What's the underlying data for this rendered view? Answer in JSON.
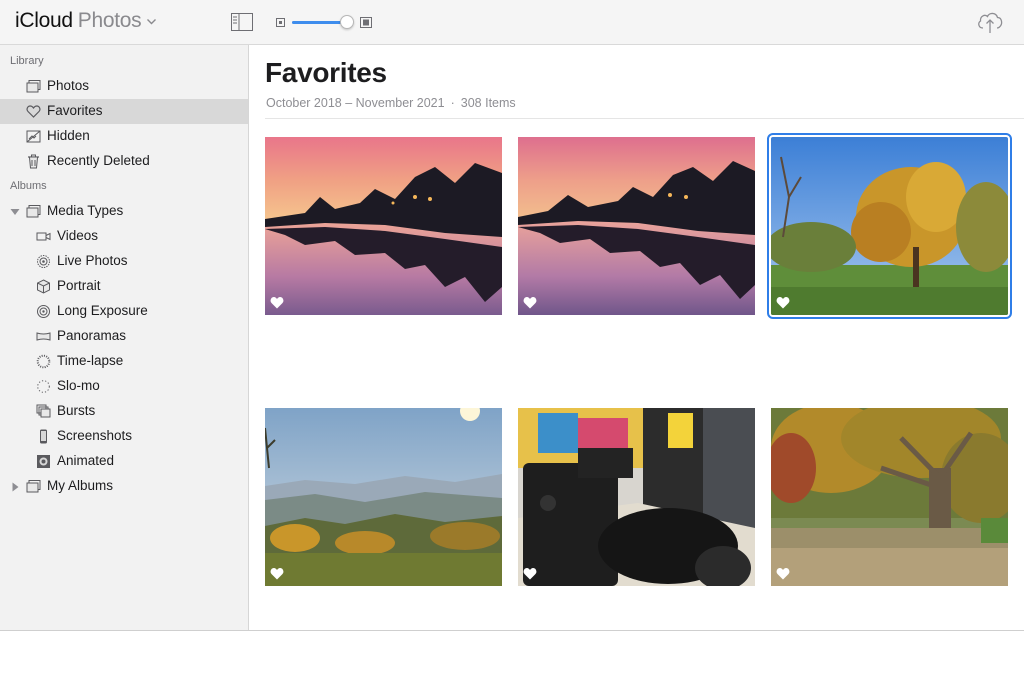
{
  "header": {
    "app_name": "iCloud",
    "section_name": "Photos"
  },
  "sidebar": {
    "library_heading": "Library",
    "library": [
      {
        "label": "Photos",
        "icon": "photos-icon"
      },
      {
        "label": "Favorites",
        "icon": "heart-icon",
        "selected": true
      },
      {
        "label": "Hidden",
        "icon": "hidden-icon"
      },
      {
        "label": "Recently Deleted",
        "icon": "trash-icon"
      }
    ],
    "albums_heading": "Albums",
    "media_types": {
      "label": "Media Types",
      "icon": "folder-icon",
      "expanded": true
    },
    "media_items": [
      {
        "label": "Videos",
        "icon": "video-icon"
      },
      {
        "label": "Live Photos",
        "icon": "live-photo-icon"
      },
      {
        "label": "Portrait",
        "icon": "cube-icon"
      },
      {
        "label": "Long Exposure",
        "icon": "long-exposure-icon"
      },
      {
        "label": "Panoramas",
        "icon": "panorama-icon"
      },
      {
        "label": "Time-lapse",
        "icon": "time-lapse-icon"
      },
      {
        "label": "Slo-mo",
        "icon": "slo-mo-icon"
      },
      {
        "label": "Bursts",
        "icon": "bursts-icon"
      },
      {
        "label": "Screenshots",
        "icon": "phone-icon"
      },
      {
        "label": "Animated",
        "icon": "animated-icon"
      }
    ],
    "my_albums": {
      "label": "My Albums",
      "icon": "folder-icon",
      "expanded": false
    }
  },
  "main": {
    "title": "Favorites",
    "date_range": "October 2018 – November 2021",
    "separator": "·",
    "item_count": "308 Items",
    "photos": [
      {
        "subject": "sunset river reflection",
        "favorite": true,
        "selected": false
      },
      {
        "subject": "sunset river reflection",
        "favorite": true,
        "selected": false
      },
      {
        "subject": "autumn tree meadow",
        "favorite": true,
        "selected": true
      },
      {
        "subject": "hazy mountain valley",
        "favorite": true,
        "selected": false
      },
      {
        "subject": "nikon camera lens",
        "favorite": true,
        "selected": false
      },
      {
        "subject": "large autumn tree",
        "favorite": true,
        "selected": false
      }
    ]
  },
  "colors": {
    "accent": "#2f7ee8",
    "sidebar_bg": "#f2f2f2",
    "selected_row": "#d8d8d8"
  }
}
